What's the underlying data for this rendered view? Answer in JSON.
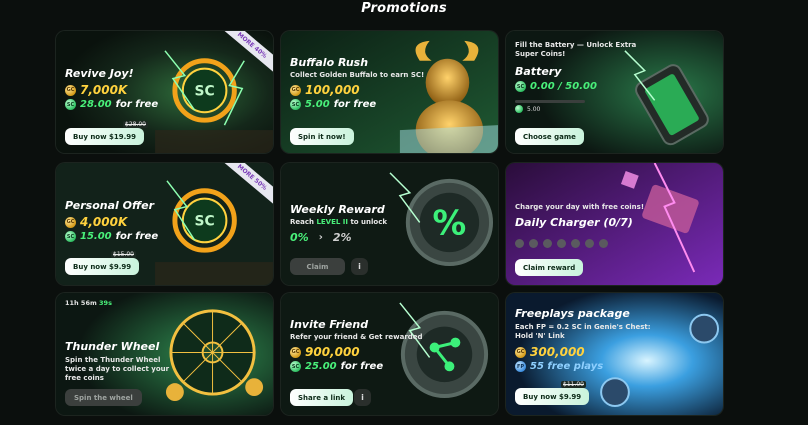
{
  "page": {
    "title": "Promotions"
  },
  "cards": [
    {
      "id": "revive-joy",
      "title": "Revive Joy!",
      "ribbon": "MORE 40%",
      "gc_amount": "7,000K",
      "sc_amount": "28.00",
      "sc_suffix": "for free",
      "old_price": "$28.00",
      "button": "Buy now $19.99"
    },
    {
      "id": "buffalo-rush",
      "title": "Buffalo Rush",
      "subtitle": "Collect Golden Buffalo to earn SC!",
      "gc_amount": "100,000",
      "sc_amount": "5.00",
      "sc_suffix": "for free",
      "button": "Spin it now!"
    },
    {
      "id": "battery",
      "subtitle": "Fill the Battery — Unlock Extra Super Coins!",
      "title": "Battery",
      "progress_text": "0.00 / 50.00",
      "progress_fraction": 0.0,
      "reward": "5.00",
      "button": "Choose game"
    },
    {
      "id": "personal-offer",
      "title": "Personal Offer",
      "ribbon": "MORE 50%",
      "gc_amount": "4,000K",
      "sc_amount": "15.00",
      "sc_suffix": "for free",
      "old_price": "$15.00",
      "button": "Buy now $9.99"
    },
    {
      "id": "weekly-reward",
      "title": "Weekly Reward",
      "subtitle_prefix": "Reach",
      "subtitle_level": "LEVEL II",
      "subtitle_suffix": "to unlock",
      "from_level": "0%",
      "to_level": "2%",
      "button": "Claim",
      "info": "i"
    },
    {
      "id": "daily-charger",
      "subtitle": "Charge your day with free coins!",
      "title": "Daily Charger (0/7)",
      "dots_total": 7,
      "dots_filled": 0,
      "button": "Claim reward"
    },
    {
      "id": "thunder-wheel",
      "timer_hm": "11h 56m",
      "timer_s": "39s",
      "title": "Thunder Wheel",
      "subtitle": "Spin the Thunder Wheel twice a day to collect your free coins",
      "button": "Spin the wheel"
    },
    {
      "id": "invite-friend",
      "title": "Invite Friend",
      "subtitle": "Refer your friend & Get rewarded",
      "gc_amount": "900,000",
      "sc_amount": "25.00",
      "sc_suffix": "for free",
      "button": "Share a link",
      "info": "i"
    },
    {
      "id": "freeplays-package",
      "title": "Freeplays package",
      "subtitle": "Each FP = 0.2 SC in Genie's Chest: Hold 'N' Link",
      "gc_amount": "300,000",
      "fp_amount": "55 free plays",
      "old_price": "$11.00",
      "button": "Buy now $9.99"
    }
  ],
  "colors": {
    "background": "#0b0f0d",
    "gold": "#ffd23e",
    "green": "#49f07a",
    "purple_card": "#6a2aa8"
  },
  "coin_labels": {
    "gold": "GC",
    "green": "SC",
    "blue": "FP"
  }
}
